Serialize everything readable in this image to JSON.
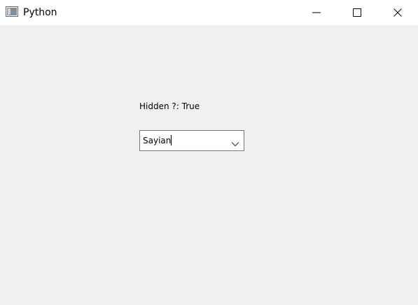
{
  "window": {
    "title": "Python",
    "icon": "python-app-icon",
    "controls": {
      "minimize_icon": "minimize-icon",
      "maximize_icon": "maximize-icon",
      "close_icon": "close-icon"
    }
  },
  "main": {
    "status_label": "Hidden ?: True",
    "combo": {
      "value": "Sayian",
      "icon": "chevron-down-icon"
    }
  }
}
